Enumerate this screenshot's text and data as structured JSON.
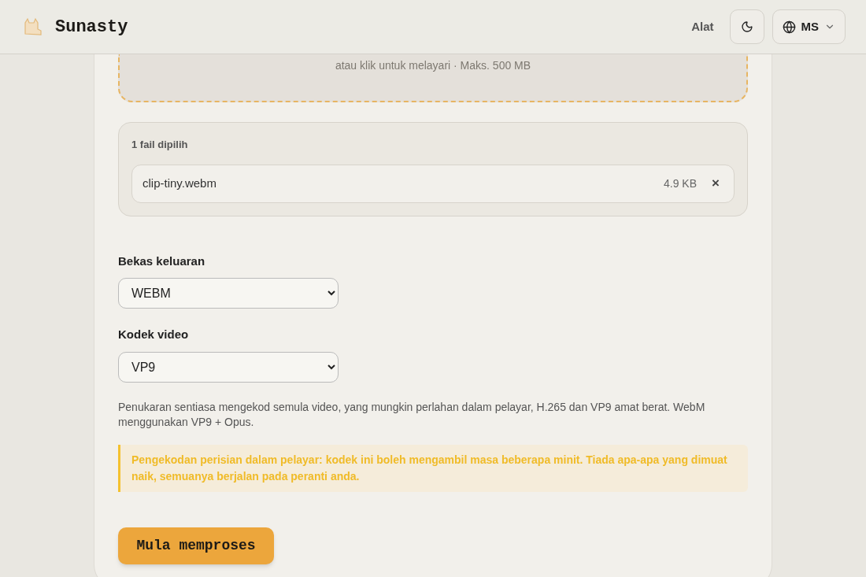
{
  "header": {
    "brand": "Sunasty",
    "nav_link": "Alat",
    "language": "MS"
  },
  "dropzone": {
    "hint": "atau klik untuk melayari · Maks. 500 MB"
  },
  "files": {
    "count_label": "1 fail dipilih",
    "items": [
      {
        "name": "clip-tiny.webm",
        "size": "4.9 KB",
        "remove": "×"
      }
    ]
  },
  "fields": [
    {
      "label": "Bekas keluaran",
      "value": "WEBM"
    },
    {
      "label": "Kodek video",
      "value": "VP9"
    }
  ],
  "note": "Penukaran sentiasa mengekod semula video, yang mungkin perlahan dalam pelayar, H.265 dan VP9 amat berat. WebM menggunakan VP9 + Opus.",
  "warning": "Pengekodan perisian dalam pelayar: kodek ini boleh mengambil masa beberapa minit. Tiada apa-apa yang dimuat naik, semuanya berjalan pada peranti anda.",
  "submit": "Mula memproses"
}
